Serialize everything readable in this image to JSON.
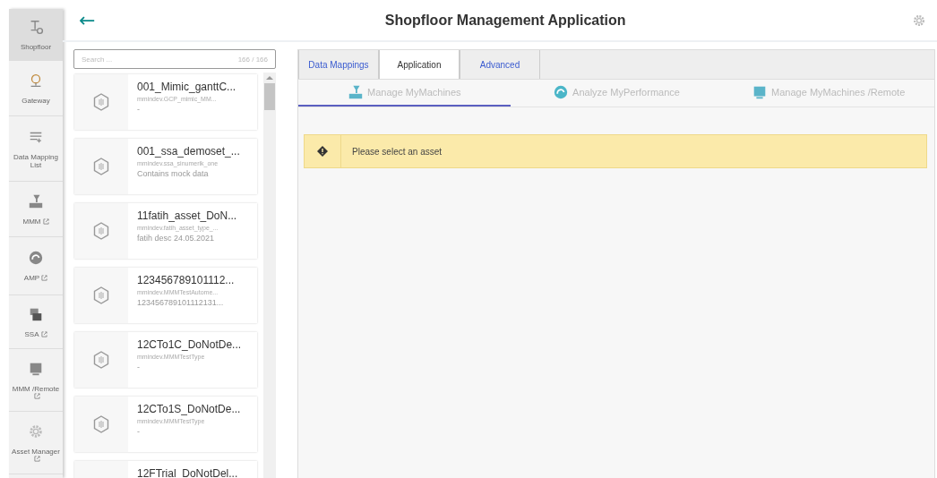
{
  "sidebar": {
    "items": [
      {
        "label": "Shopfloor",
        "kind": "shopfloor",
        "external": false,
        "selected": true
      },
      {
        "label": "Gateway",
        "kind": "gateway",
        "external": false,
        "selected": false
      },
      {
        "label": "Data Mapping List",
        "kind": "list",
        "external": false,
        "selected": false
      },
      {
        "label": "MMM",
        "kind": "machine",
        "external": true,
        "selected": false
      },
      {
        "label": "AMP",
        "kind": "gauge",
        "external": true,
        "selected": false
      },
      {
        "label": "SSA",
        "kind": "ssa",
        "external": true,
        "selected": false
      },
      {
        "label": "MMM /Remote",
        "kind": "remote",
        "external": true,
        "selected": false
      },
      {
        "label": "Asset Manager",
        "kind": "gear",
        "external": true,
        "selected": false
      }
    ]
  },
  "header": {
    "back": "←",
    "title": "Shopfloor Management Application"
  },
  "asset_list": {
    "search": {
      "placeholder": "Search ...",
      "count": "166 / 166"
    },
    "assets": [
      {
        "name": "001_Mimic_ganttC...",
        "type": "mmindev.GCP_mimic_MM...",
        "description": "-"
      },
      {
        "name": "001_ssa_demoset_...",
        "type": "mmindev.ssa_sinumerik_one",
        "description": "Contains mock data"
      },
      {
        "name": "11fatih_asset_DoN...",
        "type": "mmindev.fatih_asset_type_...",
        "description": "fatih desc 24.05.2021"
      },
      {
        "name": "123456789101112...",
        "type": "mmindev.MMMTestAutome...",
        "description": "123456789101112131..."
      },
      {
        "name": "12CTo1C_DoNotDe...",
        "type": "mmindev.MMMTestType",
        "description": "-"
      },
      {
        "name": "12CTo1S_DoNotDe...",
        "type": "mmindev.MMMTestType",
        "description": "-"
      },
      {
        "name": "12FTrial_DoNotDel..."
      }
    ]
  },
  "tabs": [
    {
      "label": "Data Mappings",
      "selected": false
    },
    {
      "label": "Application",
      "selected": true
    },
    {
      "label": "Advanced",
      "selected": false
    }
  ],
  "app_tabs": [
    {
      "label": "Manage MyMachines",
      "kind": "machine",
      "selected": true
    },
    {
      "label": "Analyze MyPerformance",
      "kind": "gauge",
      "selected": false
    },
    {
      "label": "Manage MyMachines /Remote",
      "kind": "remote",
      "selected": false
    }
  ],
  "alert": {
    "message": "Please select an asset"
  }
}
